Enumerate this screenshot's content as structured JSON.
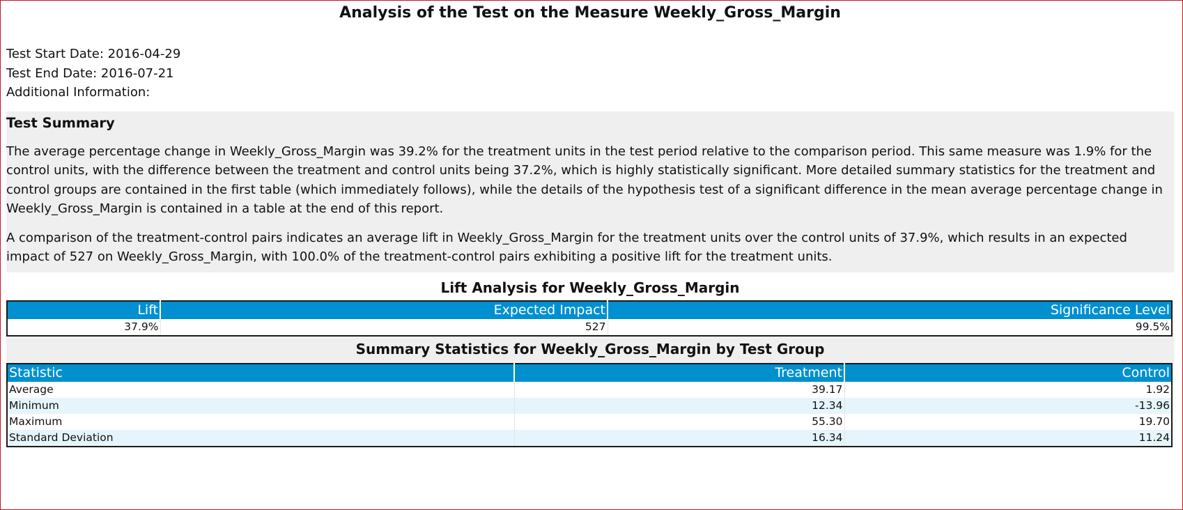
{
  "report": {
    "title": "Analysis of the Test on the Measure Weekly_Gross_Margin",
    "start_date": "Test Start Date: 2016-04-29",
    "end_date": "Test End Date: 2016-07-21",
    "additional_info": "Additional Information:"
  },
  "summary": {
    "heading": "Test Summary",
    "paragraph1": "The average percentage change in Weekly_Gross_Margin was 39.2% for the treatment units in the test period relative to the comparison period. This same measure was 1.9% for the control units, with the difference between the treatment and control units being 37.2%, which is highly statistically significant. More detailed summary statistics for the treatment and control groups are contained in the first table (which immediately follows), while the details of the hypothesis test of a significant difference in the mean average percentage change in Weekly_Gross_Margin is contained in a table at the end of this report.",
    "paragraph2": "A comparison of the treatment-control pairs indicates an average lift in Weekly_Gross_Margin for the treatment units over the control units of 37.9%, which results in an expected impact of 527 on Weekly_Gross_Margin, with 100.0% of the treatment-control pairs exhibiting a positive lift for the treatment units."
  },
  "lift_table": {
    "title": "Lift Analysis for Weekly_Gross_Margin",
    "headers": [
      "Lift",
      "Expected Impact",
      "Significance Level"
    ],
    "row": [
      "37.9%",
      "527",
      "99.5%"
    ]
  },
  "stats_table": {
    "title": "Summary Statistics for Weekly_Gross_Margin by Test Group",
    "headers": [
      "Statistic",
      "Treatment",
      "Control"
    ],
    "rows": [
      [
        "Average",
        "39.17",
        "1.92"
      ],
      [
        "Minimum",
        "12.34",
        "-13.96"
      ],
      [
        "Maximum",
        "55.30",
        "19.70"
      ],
      [
        "Standard Deviation",
        "16.34",
        "11.24"
      ]
    ]
  },
  "colors": {
    "header_bg": "#0090d0",
    "band_bg": "#efefef",
    "alt_row_bg": "#e6f5fc",
    "frame_border": "#c8141e"
  }
}
